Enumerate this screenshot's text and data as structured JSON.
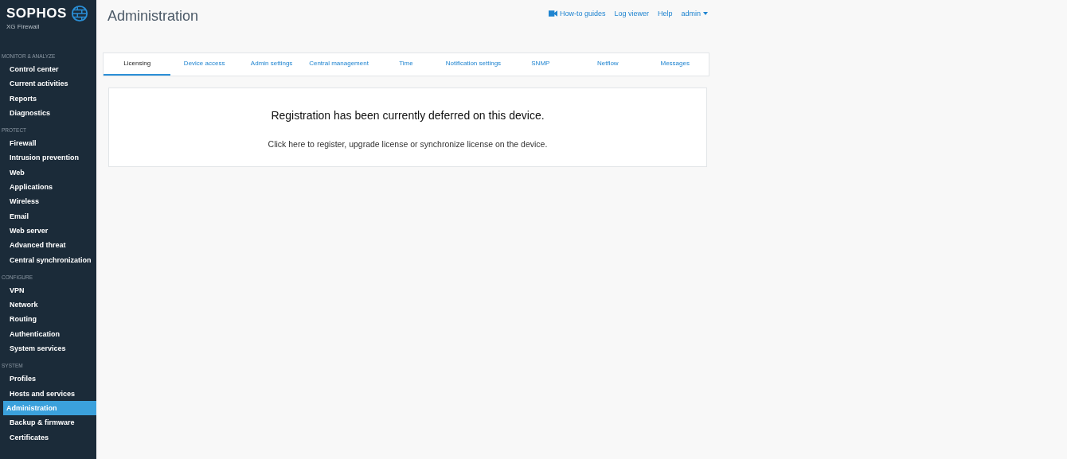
{
  "brand": {
    "name": "SOPHOS",
    "product": "XG Firewall"
  },
  "sidebar": [
    {
      "heading": "MONITOR & ANALYZE",
      "items": [
        {
          "label": "Control center",
          "selected": false
        },
        {
          "label": "Current activities",
          "selected": false
        },
        {
          "label": "Reports",
          "selected": false
        },
        {
          "label": "Diagnostics",
          "selected": false
        }
      ]
    },
    {
      "heading": "PROTECT",
      "items": [
        {
          "label": "Firewall",
          "selected": false
        },
        {
          "label": "Intrusion prevention",
          "selected": false
        },
        {
          "label": "Web",
          "selected": false
        },
        {
          "label": "Applications",
          "selected": false
        },
        {
          "label": "Wireless",
          "selected": false
        },
        {
          "label": "Email",
          "selected": false
        },
        {
          "label": "Web server",
          "selected": false
        },
        {
          "label": "Advanced threat",
          "selected": false
        },
        {
          "label": "Central synchronization",
          "selected": false
        }
      ]
    },
    {
      "heading": "CONFIGURE",
      "items": [
        {
          "label": "VPN",
          "selected": false
        },
        {
          "label": "Network",
          "selected": false
        },
        {
          "label": "Routing",
          "selected": false
        },
        {
          "label": "Authentication",
          "selected": false
        },
        {
          "label": "System services",
          "selected": false
        }
      ]
    },
    {
      "heading": "SYSTEM",
      "items": [
        {
          "label": "Profiles",
          "selected": false
        },
        {
          "label": "Hosts and services",
          "selected": false
        },
        {
          "label": "Administration",
          "selected": true
        },
        {
          "label": "Backup & firmware",
          "selected": false
        },
        {
          "label": "Certificates",
          "selected": false
        }
      ]
    }
  ],
  "page_title": "Administration",
  "header_links": [
    {
      "label": "How-to guides",
      "kind": "video"
    },
    {
      "label": "Log viewer",
      "kind": "plain"
    },
    {
      "label": "Help",
      "kind": "plain"
    },
    {
      "label": "admin",
      "kind": "menu"
    }
  ],
  "tabs": [
    {
      "label": "Licensing",
      "selected": true
    },
    {
      "label": "Device access",
      "selected": false
    },
    {
      "label": "Admin settings",
      "selected": false
    },
    {
      "label": "Central management",
      "selected": false
    },
    {
      "label": "Time",
      "selected": false
    },
    {
      "label": "Notification settings",
      "selected": false
    },
    {
      "label": "SNMP",
      "selected": false
    },
    {
      "label": "Netflow",
      "selected": false
    },
    {
      "label": "Messages",
      "selected": false
    }
  ],
  "message": {
    "title": "Registration has been currently deferred on this device.",
    "link": "Click here to register, upgrade license or synchronize license on the device."
  }
}
